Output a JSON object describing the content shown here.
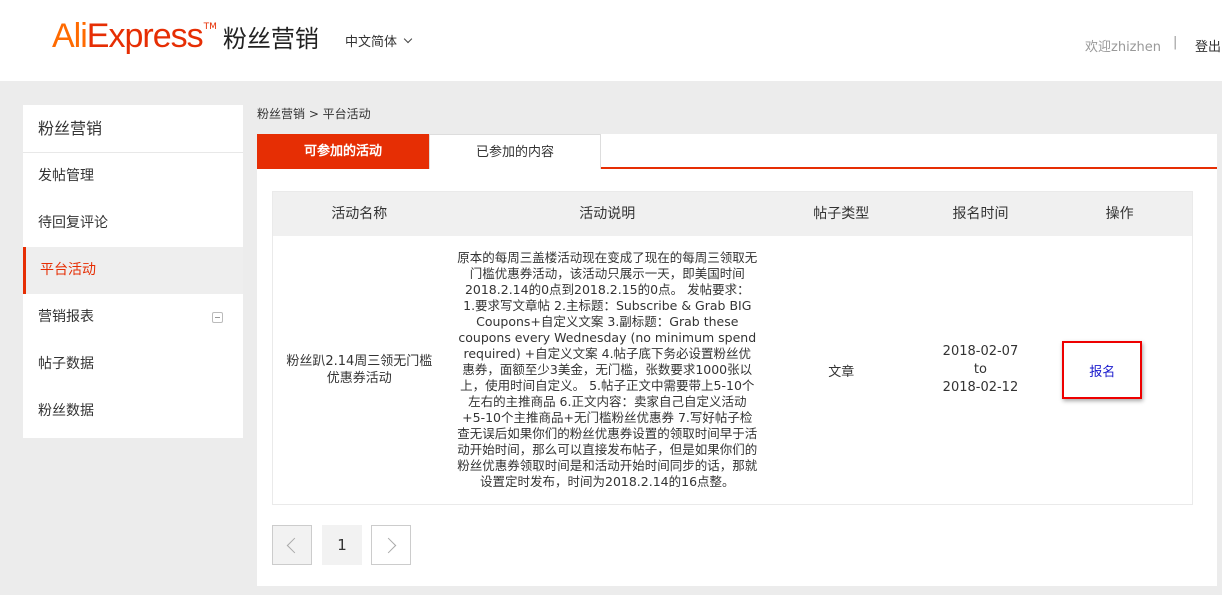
{
  "header": {
    "logo_main": "Ali",
    "logo_express": "Express",
    "logo_tm": "TM",
    "logo_sub": "粉丝营销",
    "language": "中文简体",
    "welcome": "欢迎zhizhen",
    "separator": "|",
    "logout": "登出"
  },
  "sidebar": {
    "title": "粉丝营销",
    "items": [
      {
        "label": "发帖管理"
      },
      {
        "label": "待回复评论"
      },
      {
        "label": "平台活动"
      },
      {
        "label": "营销报表"
      },
      {
        "label": "帖子数据"
      },
      {
        "label": "粉丝数据"
      }
    ]
  },
  "breadcrumb": "粉丝营销 > 平台活动",
  "tabs": [
    {
      "label": "可参加的活动"
    },
    {
      "label": "已参加的内容"
    }
  ],
  "table": {
    "headers": [
      "活动名称",
      "活动说明",
      "帖子类型",
      "报名时间",
      "操作"
    ],
    "rows": [
      {
        "name": "粉丝趴2.14周三领无门槛优惠券活动",
        "description": "原本的每周三盖楼活动现在变成了现在的每周三领取无门槛优惠券活动，该活动只展示一天，即美国时间2018.2.14的0点到2018.2.15的0点。 发帖要求： 1.要求写文章帖 2.主标题：Subscribe & Grab BIG Coupons+自定义文案 3.副标题：Grab these coupons every Wednesday (no minimum spend required) +自定义文案 4.帖子底下务必设置粉丝优惠券，面额至少3美金，无门槛，张数要求1000张以上，使用时间自定义。 5.帖子正文中需要带上5-10个左右的主推商品 6.正文内容：卖家自己自定义活动+5-10个主推商品+无门槛粉丝优惠券 7.写好帖子检查无误后如果你们的粉丝优惠券设置的领取时间早于活动开始时间，那么可以直接发布帖子，但是如果你们的粉丝优惠券领取时间是和活动开始时间同步的话，那就设置定时发布，时间为2018.2.14的16点整。",
        "post_type": "文章",
        "start": "2018-02-07",
        "to": "to",
        "end": "2018-02-12",
        "action": "报名"
      }
    ]
  },
  "pagination": {
    "current": "1"
  },
  "colors": {
    "accent": "#e62e04",
    "logo_orange": "#ff6a00",
    "link": "#1a1acd"
  }
}
